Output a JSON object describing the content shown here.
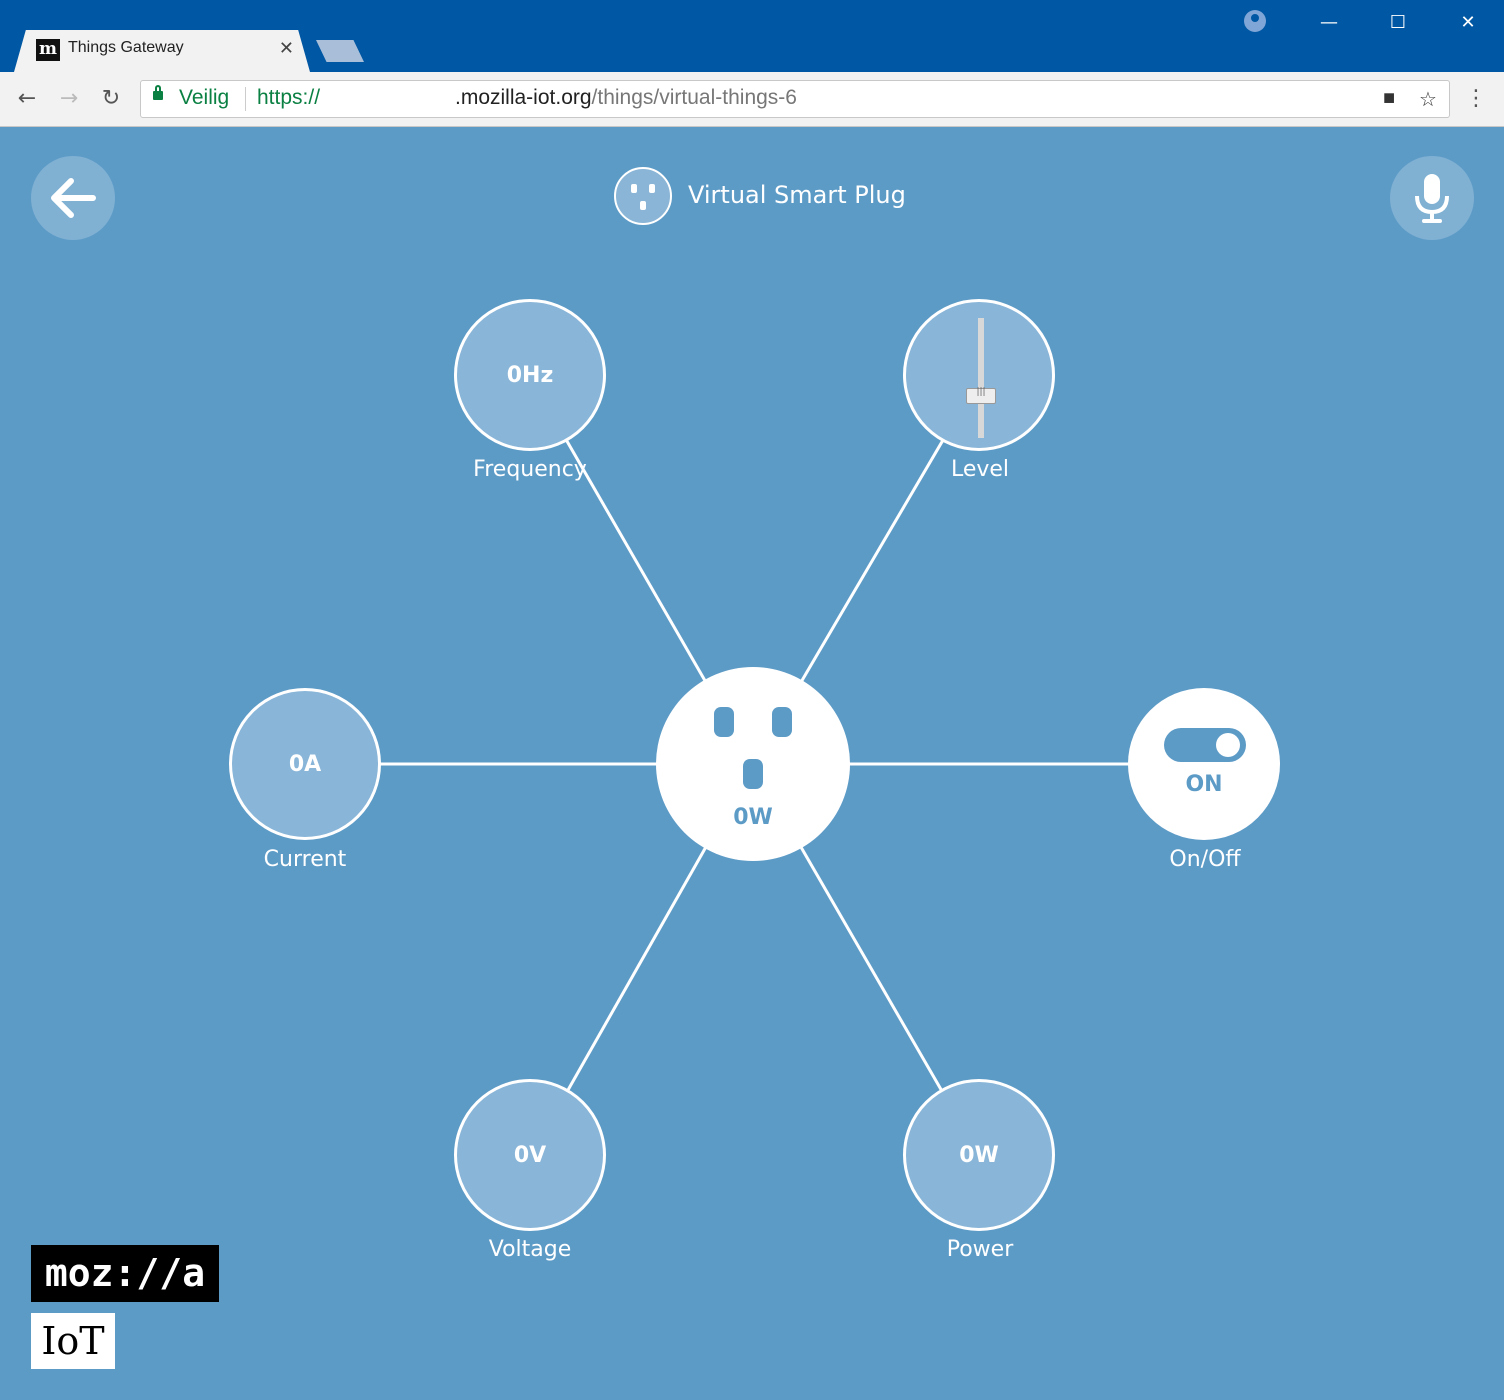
{
  "browser": {
    "tab": {
      "favicon_letter": "m",
      "title": "Things Gateway",
      "close": "✕"
    },
    "controls": {
      "profile": "profile-icon",
      "minimize": "—",
      "maximize": "☐",
      "close": "✕"
    },
    "nav": {
      "back": "←",
      "forward": "→",
      "reload": "↻",
      "menu": "⋮"
    },
    "address": {
      "secure_label": "Veilig",
      "scheme": "https://",
      "host": ".mozilla-iot.org",
      "path": "/things/virtual-things-6",
      "camera_icon": "■",
      "bookmark_icon": "☆"
    }
  },
  "header": {
    "title": "Virtual Smart Plug"
  },
  "center": {
    "value": "0W"
  },
  "properties": {
    "frequency": {
      "value": "0Hz",
      "label": "Frequency"
    },
    "level": {
      "label": "Level",
      "level_fraction": 0.35
    },
    "current": {
      "value": "0A",
      "label": "Current"
    },
    "onoff": {
      "state": "ON",
      "label": "On/Off"
    },
    "voltage": {
      "value": "0V",
      "label": "Voltage"
    },
    "power": {
      "value": "0W",
      "label": "Power"
    }
  },
  "branding": {
    "mozilla": "moz://a",
    "iot": "IoT"
  },
  "colors": {
    "chrome": "#0057a3",
    "page": "#5d9bc7",
    "property_fill": "#89b5d8",
    "secure": "#0b8043"
  }
}
